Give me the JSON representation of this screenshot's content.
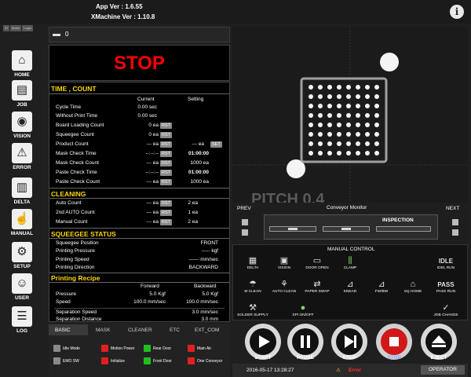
{
  "header": {
    "app_ver": "App Ver : 1.6.55",
    "xmachine_ver": "XMachine Ver : 1.10.8",
    "info_icon": "info-icon"
  },
  "mini_tabs": [
    "ID",
    "Motor",
    "Login"
  ],
  "sidebar": {
    "items": [
      {
        "label": "HOME",
        "icon": "home-icon"
      },
      {
        "label": "JOB",
        "icon": "job-icon"
      },
      {
        "label": "VISION",
        "icon": "camera-icon"
      },
      {
        "label": "ERROR",
        "icon": "warning-icon"
      },
      {
        "label": "DELTA",
        "icon": "delta-icon"
      },
      {
        "label": "MANUAL",
        "icon": "manual-icon"
      },
      {
        "label": "SETUP",
        "icon": "gear-icon"
      },
      {
        "label": "USER",
        "icon": "user-icon"
      },
      {
        "label": "LOG",
        "icon": "log-icon"
      }
    ]
  },
  "folder": {
    "value": "0"
  },
  "machine_state": "STOP",
  "time_count": {
    "title": "TIME , COUNT",
    "col_current": "Current",
    "col_setting": "Setting",
    "rows": [
      {
        "label": "Cycle Time",
        "current": "0.00 sec"
      },
      {
        "label": "Without Print Time",
        "current": "0.00 sec"
      },
      {
        "label": "Board Loading Count",
        "current": "0 ea",
        "rst": "RST"
      },
      {
        "label": "Squeegee Count",
        "current": "0 ea",
        "rst": "RST"
      },
      {
        "label": "Product Count",
        "current": "--- ea",
        "rst": "RST",
        "setting": "--- ea",
        "set": "SET"
      },
      {
        "label": "Mask Check Time",
        "current": "--:--:--",
        "rst": "RST",
        "setting": "01:00:00"
      },
      {
        "label": "Mask Check Count",
        "current": "--- ea",
        "rst": "RST",
        "setting": "1000 ea"
      },
      {
        "label": "Paste Check Time",
        "current": "--:--:--",
        "rst": "RST",
        "setting": "01:00:00"
      },
      {
        "label": "Paste Check Count",
        "current": "--- ea",
        "rst": "RST",
        "setting": "1000 ea"
      }
    ]
  },
  "cleaning": {
    "title": "CLEANING",
    "rows": [
      {
        "label": "Auto Count",
        "current": "--- ea",
        "rst": "RST",
        "setting": "2 ea"
      },
      {
        "label": "2nd AUTO Count",
        "current": "--- ea",
        "rst": "RST",
        "setting": "1 ea"
      },
      {
        "label": "Manual Count",
        "current": "--- ea",
        "rst": "RST",
        "setting": "2 ea"
      }
    ]
  },
  "squeegee_status": {
    "title": "SQUEEGEE STATUS",
    "rows": [
      {
        "label": "Squeegee Position",
        "value": "FRONT"
      },
      {
        "label": "Printing Pressure",
        "value": "----- kgf"
      },
      {
        "label": "Printing Speed",
        "value": "------ mm/sec"
      },
      {
        "label": "Printing Direction",
        "value": "BACKWARD"
      }
    ]
  },
  "printing_recipe": {
    "title": "Printing Recipe",
    "col_forward": "Forward",
    "col_backward": "Backward",
    "rows": [
      {
        "label": "Pressure",
        "forward": "5.0 Kgf",
        "backward": "5.0 Kgf"
      },
      {
        "label": "Speed",
        "forward": "100.0 mm/sec",
        "backward": "100.0 mm/sec"
      }
    ],
    "sep_rows": [
      {
        "label": "Separation Speed",
        "value": "3.0 mm/sec"
      },
      {
        "label": "Separation Distance",
        "value": "3.0 mm"
      }
    ]
  },
  "conveyor": {
    "title": "Conveyor Monitor",
    "prev": "PREV",
    "next": "NEXT",
    "inspection": "INSPECTION"
  },
  "manual_control": {
    "title": "MANUAL CONTROL",
    "buttons": [
      {
        "label": "DELTA",
        "icon": "delta-icon"
      },
      {
        "label": "VISION",
        "icon": "vision-icon"
      },
      {
        "label": "DOOR OPEN",
        "icon": "door-icon"
      },
      {
        "label": "CLAMP",
        "icon": "clamp-icon"
      },
      {
        "label": "IDEL RUN",
        "icon": "IDLE"
      },
      {
        "label": "M CLEAN",
        "icon": "clean-icon"
      },
      {
        "label": "AUTO CLEAN",
        "icon": "auto-clean-icon"
      },
      {
        "label": "PAPER SWAP",
        "icon": "paper-icon"
      },
      {
        "label": "KNEAD",
        "icon": "knead-icon"
      },
      {
        "label": "FW/BW",
        "icon": "fwbw-icon"
      },
      {
        "label": "SQ HOME",
        "icon": "home-icon"
      },
      {
        "label": "PASS RUN",
        "icon": "PASS"
      },
      {
        "label": "SOLDER SUPPLY",
        "icon": "solder-icon"
      },
      {
        "label": "SPI ON/OFF",
        "icon": "spi-icon"
      },
      {
        "label": "JOB CHANGE",
        "icon": "check-icon"
      }
    ]
  },
  "bottom_tabs": [
    "BASIC",
    "MASK",
    "CLEANER",
    "ETC",
    "EXT_COM"
  ],
  "io_leds": [
    {
      "label": "Idle Mode",
      "color": "#8a8a8a"
    },
    {
      "label": "Motion Power",
      "color": "#e02020"
    },
    {
      "label": "Rear Door",
      "color": "#1fbf1f"
    },
    {
      "label": "Main Air",
      "color": "#e02020"
    },
    {
      "label": "EMO SW",
      "color": "#8a8a8a"
    },
    {
      "label": "Initialize",
      "color": "#e02020"
    },
    {
      "label": "Front Door",
      "color": "#1fbf1f"
    },
    {
      "label": "One Conveyor",
      "color": "#e02020"
    }
  ],
  "transport": [
    {
      "label": "START",
      "icon": "play-icon"
    },
    {
      "label": "PAUSE",
      "icon": "pause-icon"
    },
    {
      "label": "STEP",
      "icon": "step-icon"
    },
    {
      "label": "STOP",
      "icon": "stop-icon"
    },
    {
      "label": "EJECT",
      "icon": "eject-icon"
    }
  ],
  "status_bar": {
    "datetime": "2016-05-17 13:28:27",
    "error": "Error",
    "user": "OPERATOR"
  },
  "colors": {
    "stop": "#ff0000",
    "section_title": "#ffd700",
    "stop_button": "#e02020"
  }
}
